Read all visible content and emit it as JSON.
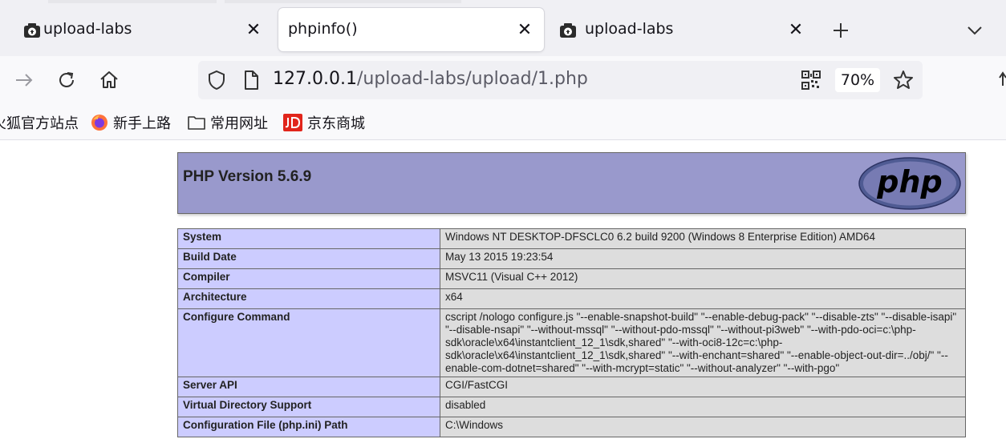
{
  "browser": {
    "tabs": [
      {
        "title": "upload-labs",
        "active": false
      },
      {
        "title": "phpinfo()",
        "active": true
      },
      {
        "title": "upload-labs",
        "active": false
      }
    ],
    "new_tab_icon": "plus-icon",
    "tab_list_icon": "chevron-down-icon",
    "url": {
      "host": "127.0.0.1",
      "path": "/upload-labs/upload/1.php"
    },
    "zoom": "70%",
    "bookmarks": [
      {
        "label": "火狐官方站点",
        "icon": "firefox-icon"
      },
      {
        "label": "新手上路",
        "icon": "firefox-icon"
      },
      {
        "label": "常用网址",
        "icon": "folder-icon"
      },
      {
        "label": "京东商城",
        "icon": "jd-icon"
      }
    ]
  },
  "page": {
    "version_title": "PHP Version 5.6.9",
    "logo_text": "php",
    "header_color": "#9999cc",
    "rows": [
      {
        "key": "System",
        "value": "Windows NT DESKTOP-DFSCLC0 6.2 build 9200 (Windows 8 Enterprise Edition) AMD64"
      },
      {
        "key": "Build Date",
        "value": "May 13 2015 19:23:54"
      },
      {
        "key": "Compiler",
        "value": "MSVC11 (Visual C++ 2012)"
      },
      {
        "key": "Architecture",
        "value": "x64"
      },
      {
        "key": "Configure Command",
        "value": "cscript /nologo configure.js \"--enable-snapshot-build\" \"--enable-debug-pack\" \"--disable-zts\" \"--disable-isapi\" \"--disable-nsapi\" \"--without-mssql\" \"--without-pdo-mssql\" \"--without-pi3web\" \"--with-pdo-oci=c:\\php-sdk\\oracle\\x64\\instantclient_12_1\\sdk,shared\" \"--with-oci8-12c=c:\\php-sdk\\oracle\\x64\\instantclient_12_1\\sdk,shared\" \"--with-enchant=shared\" \"--enable-object-out-dir=../obj/\" \"--enable-com-dotnet=shared\" \"--with-mcrypt=static\" \"--without-analyzer\" \"--with-pgo\""
      },
      {
        "key": "Server API",
        "value": "CGI/FastCGI"
      },
      {
        "key": "Virtual Directory Support",
        "value": "disabled"
      },
      {
        "key": "Configuration File (php.ini) Path",
        "value": "C:\\Windows"
      }
    ]
  }
}
